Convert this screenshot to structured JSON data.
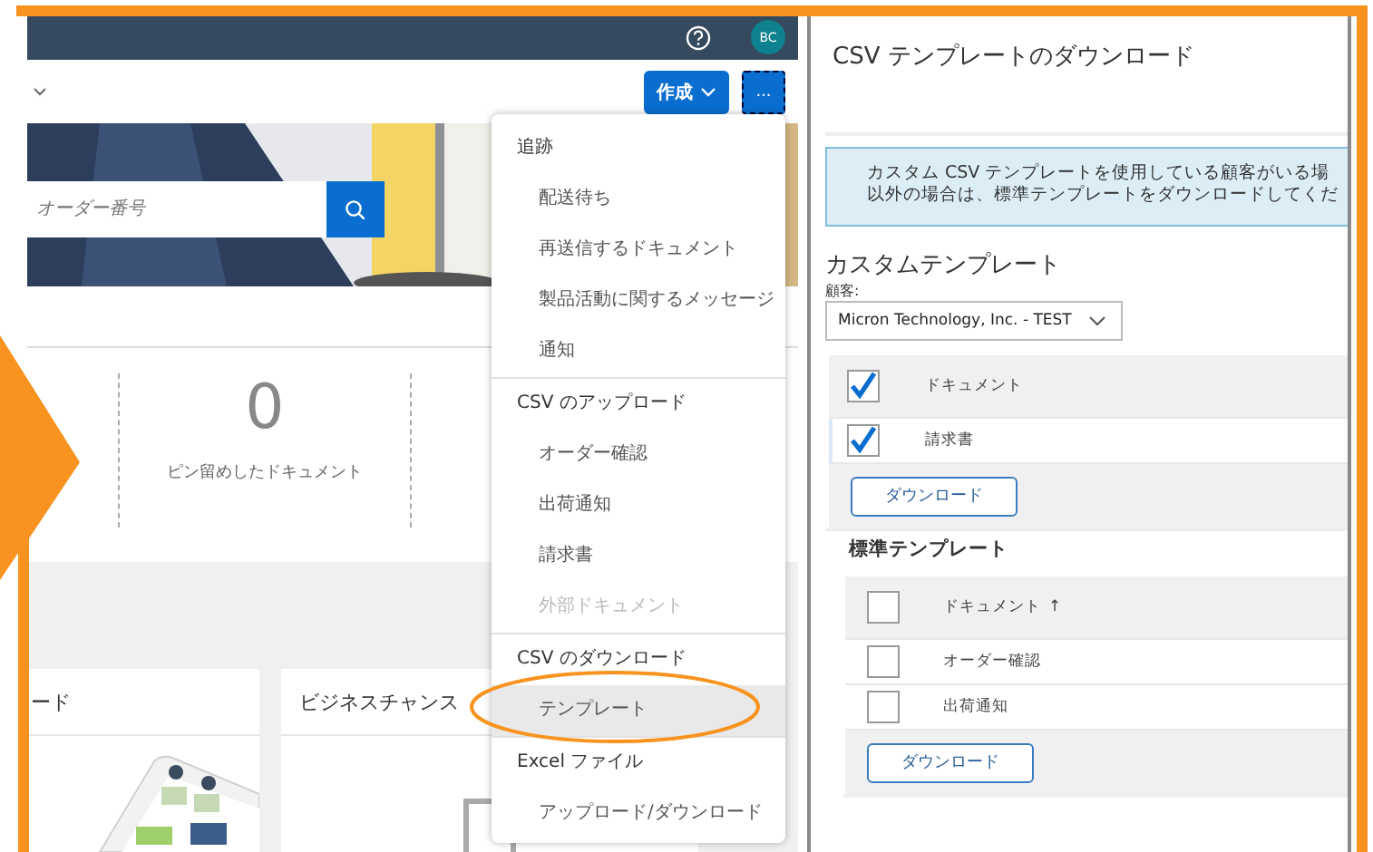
{
  "header": {
    "avatar": "BC"
  },
  "toolbar": {
    "create_button": "作成",
    "more_button": "..."
  },
  "search": {
    "placeholder": "オーダー番号"
  },
  "stats": [
    {
      "value": "0",
      "label": "ピン留めしたドキュメント"
    }
  ],
  "cards": [
    {
      "title": "ード",
      "kind": "picture"
    },
    {
      "title": "ビジネスチャンス",
      "kind": "file"
    }
  ],
  "menu": {
    "sections": [
      {
        "title": "追跡",
        "items": [
          {
            "label": "配送待ち",
            "disabled": false,
            "selected": false
          },
          {
            "label": "再送信するドキュメント",
            "disabled": false,
            "selected": false
          },
          {
            "label": "製品活動に関するメッセージ",
            "disabled": false,
            "selected": false
          },
          {
            "label": "通知",
            "disabled": false,
            "selected": false
          }
        ]
      },
      {
        "title": "CSV のアップロード",
        "items": [
          {
            "label": "オーダー確認",
            "disabled": false,
            "selected": false
          },
          {
            "label": "出荷通知",
            "disabled": false,
            "selected": false
          },
          {
            "label": "請求書",
            "disabled": false,
            "selected": false
          },
          {
            "label": "外部ドキュメント",
            "disabled": true,
            "selected": false
          }
        ]
      },
      {
        "title": "CSV のダウンロード",
        "items": [
          {
            "label": "テンプレート",
            "disabled": false,
            "selected": true
          }
        ]
      },
      {
        "title": "Excel ファイル",
        "items": [
          {
            "label": "アップロード/ダウンロード",
            "disabled": false,
            "selected": false
          }
        ]
      }
    ]
  },
  "panel": {
    "title": "CSV テンプレートのダウンロード",
    "info": [
      "カスタム CSV テンプレートを使用している顧客がいる場",
      "以外の場合は、標準テンプレートをダウンロードしてくだ"
    ],
    "custom": {
      "heading": "カスタムテンプレート",
      "customer_label": "顧客:",
      "customer_value": "Micron Technology, Inc. - TEST",
      "table": {
        "header": {
          "label": "ドキュメント",
          "checked": true
        },
        "rows": [
          {
            "label": "請求書",
            "checked": true
          }
        ]
      },
      "button": "ダウンロード"
    },
    "standard": {
      "heading": "標準テンプレート",
      "table": {
        "header": {
          "label": "ドキュメント",
          "sort": "↑",
          "checked": false
        },
        "rows": [
          {
            "label": "オーダー確認",
            "checked": false
          },
          {
            "label": "出荷通知",
            "checked": false
          }
        ]
      },
      "button": "ダウンロード"
    }
  }
}
